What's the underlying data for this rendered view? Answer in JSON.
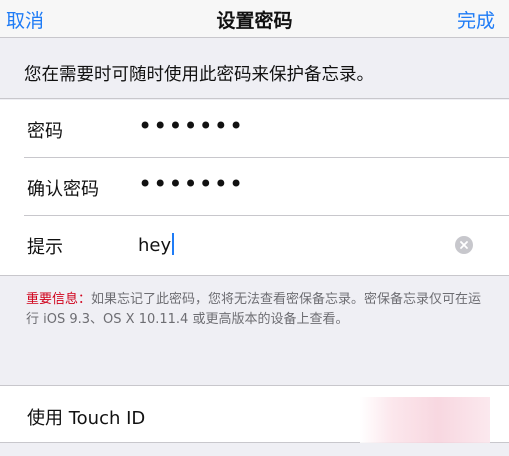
{
  "navbar": {
    "cancel_label": "取消",
    "title": "设置密码",
    "done_label": "完成"
  },
  "notice": "您在需要时可随时使用此密码来保护备忘录。",
  "form": {
    "password_label": "密码",
    "password_value": "•••••••",
    "confirm_label": "确认密码",
    "confirm_value": "•••••••",
    "hint_label": "提示",
    "hint_value": "hey"
  },
  "warning": {
    "important_label": "重要信息：",
    "text": "如果忘记了此密码，您将无法查看密保备忘录。密保备忘录仅可在运行 iOS 9.3、OS X 10.11.4 或更高版本的设备上查看。"
  },
  "touch_id_label": "使用 Touch ID",
  "colors": {
    "accent": "#1f7cf6",
    "warning_red": "#d0021b"
  }
}
